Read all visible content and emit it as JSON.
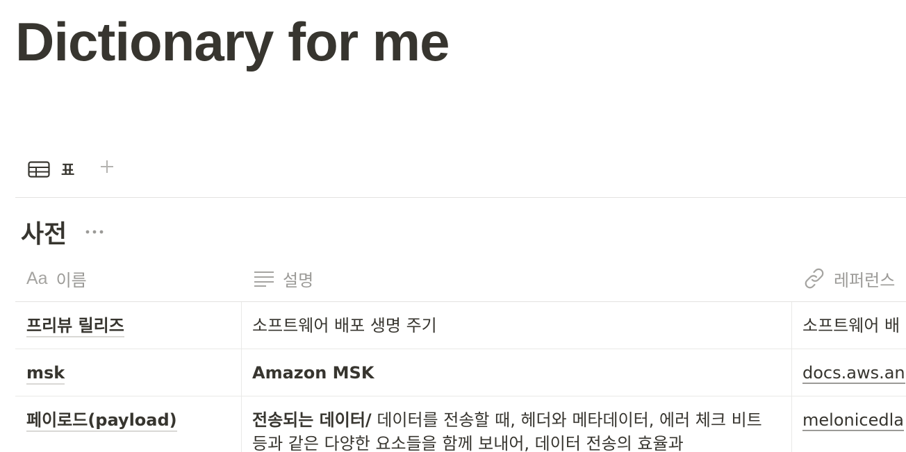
{
  "page": {
    "title": "Dictionary for me"
  },
  "view_tabs": {
    "tabs": [
      {
        "label": "표",
        "icon": "table-icon"
      }
    ],
    "add_icon": "plus-icon"
  },
  "database": {
    "title": "사전",
    "more_icon": "more-horizontal-icon"
  },
  "table": {
    "columns": [
      {
        "label": "이름",
        "icon": "Aa"
      },
      {
        "label": "설명",
        "icon": "text-lines-icon"
      },
      {
        "label": "레퍼런스",
        "icon": "link-icon"
      }
    ],
    "rows": [
      {
        "name": "프리뷰 릴리즈",
        "description_bold": "",
        "description": "소프트웨어 배포 생명 주기",
        "reference": "소프트웨어 배"
      },
      {
        "name": "msk",
        "description_bold": "Amazon MSK",
        "description": "",
        "reference": "docs.aws.an"
      },
      {
        "name": "페이로드(payload)",
        "description_bold": "전송되는 데이터/",
        "description": " 데이터를 전송할 때, 헤더와 메타데이터, 에러 체크 비트 등과 같은 다양한 요소들을 함께 보내어, 데이터 전송의 효율과",
        "reference": "melonicedla"
      }
    ]
  },
  "colors": {
    "text": "#37352f",
    "muted": "#9b9a97",
    "border": "#e9e9e7"
  }
}
